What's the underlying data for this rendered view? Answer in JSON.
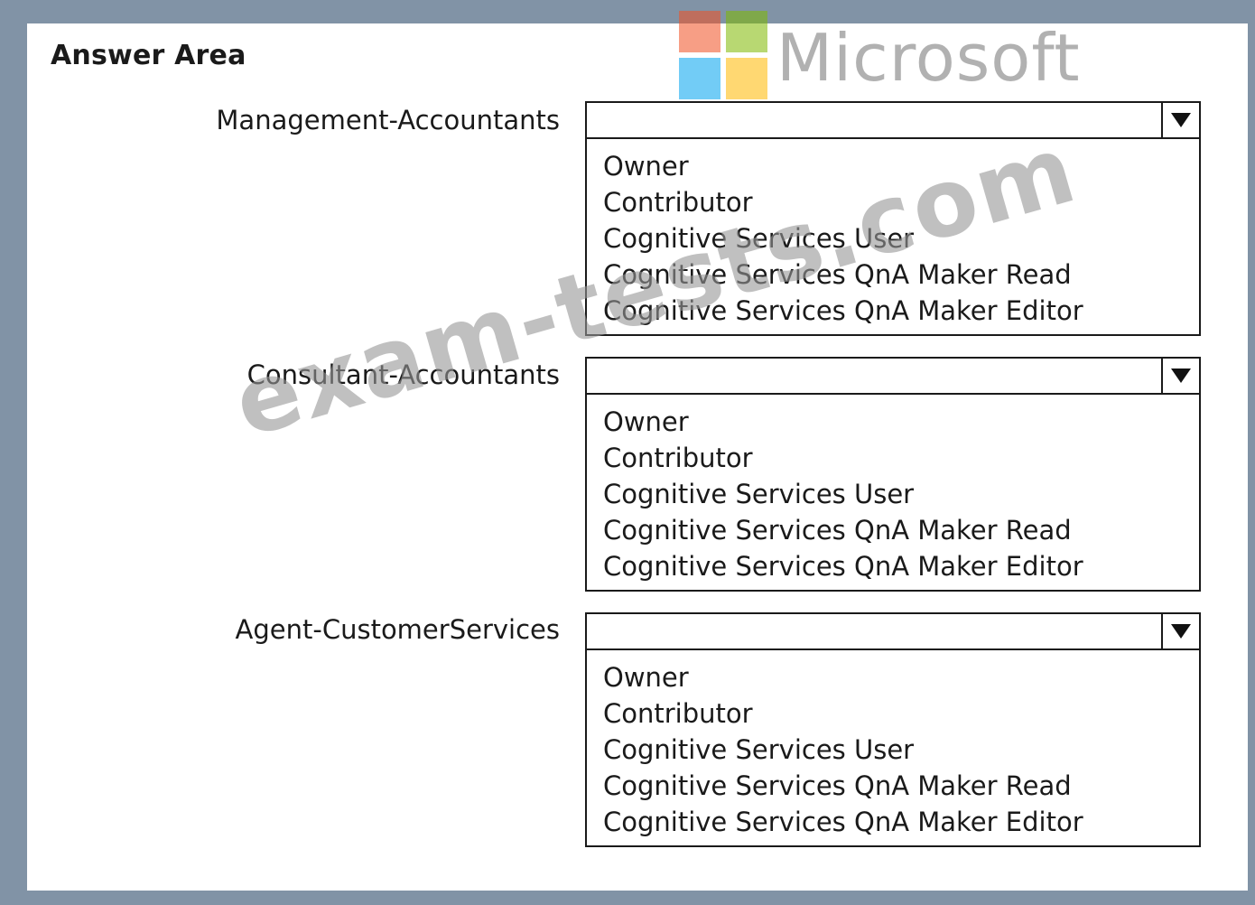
{
  "title": "Answer Area",
  "logo": {
    "text": "Microsoft",
    "colors": [
      "#f25022",
      "#7fba00",
      "#00a4ef",
      "#ffb900"
    ]
  },
  "watermark": "exam-tests.com",
  "rows": [
    {
      "label": "Management-Accountants",
      "selected": "",
      "options": [
        "Owner",
        "Contributor",
        "Cognitive Services User",
        "Cognitive Services QnA Maker Read",
        "Cognitive Services QnA Maker Editor"
      ]
    },
    {
      "label": "Consultant-Accountants",
      "selected": "",
      "options": [
        "Owner",
        "Contributor",
        "Cognitive Services User",
        "Cognitive Services QnA Maker Read",
        "Cognitive Services QnA Maker Editor"
      ]
    },
    {
      "label": "Agent-CustomerServices",
      "selected": "",
      "options": [
        "Owner",
        "Contributor",
        "Cognitive Services User",
        "Cognitive Services QnA Maker Read",
        "Cognitive Services QnA Maker Editor"
      ]
    }
  ],
  "icons": {
    "dropdown_arrow": "triangle-down"
  }
}
